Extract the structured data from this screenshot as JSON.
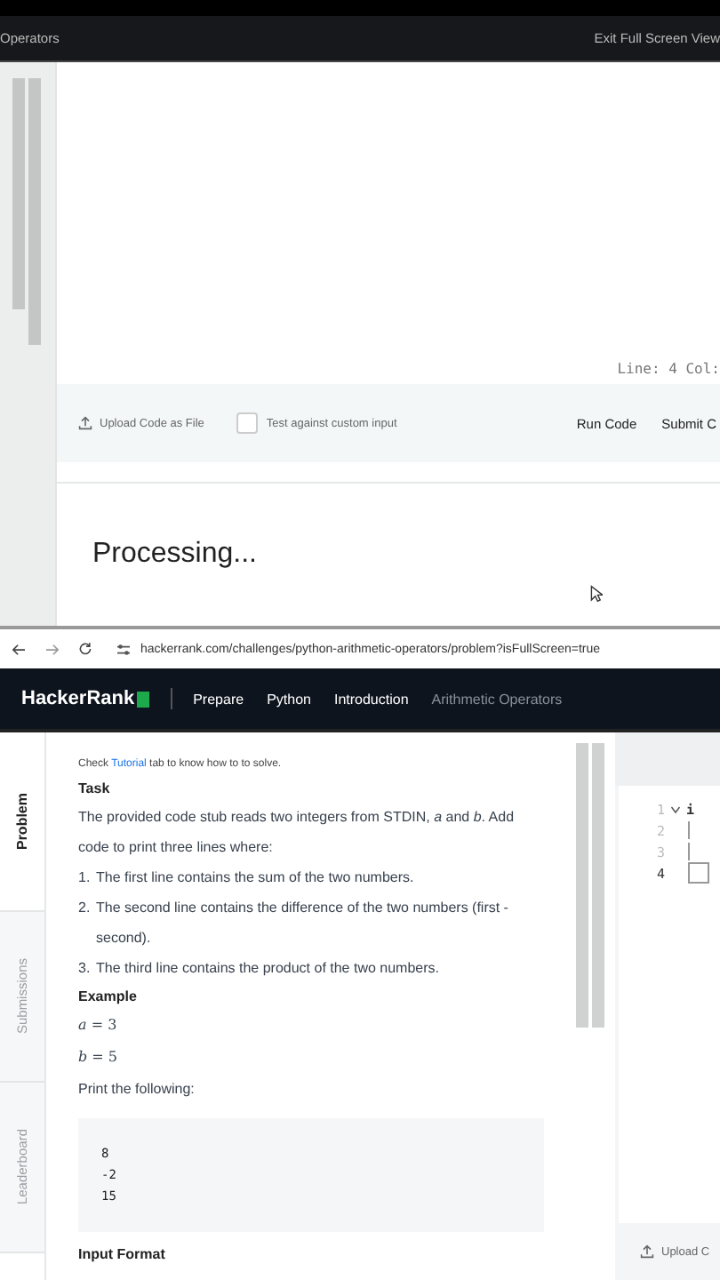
{
  "fullscreen_header": {
    "title": "Operators",
    "exit_link": "Exit Full Screen View"
  },
  "editor": {
    "cursor_position": "Line: 4 Col:"
  },
  "editor_footer": {
    "upload": "Upload Code as File",
    "custom_input": {
      "label": "Test against custom input",
      "checked": false
    },
    "buttons": [
      "Run Code",
      "Submit C"
    ]
  },
  "output": {
    "status": "Processing..."
  },
  "browser": {
    "url": "hackerrank.com/challenges/python-arithmetic-operators/problem?isFullScreen=true"
  },
  "nav": {
    "logo": "HackerRank",
    "breadcrumbs": [
      {
        "label": "Prepare",
        "current": false
      },
      {
        "label": "Python",
        "current": false
      },
      {
        "label": "Introduction",
        "current": false
      },
      {
        "label": "Arithmetic Operators",
        "current": true
      }
    ]
  },
  "side_tabs": [
    {
      "label": "Problem",
      "selected": true
    },
    {
      "label": "Submissions",
      "selected": false
    },
    {
      "label": "Leaderboard",
      "selected": false
    }
  ],
  "problem": {
    "hint_before": "Check",
    "hint_link": "Tutorial",
    "hint_after": "tab to know how to to solve.",
    "task_heading": "Task",
    "task_text": "The provided code stub reads two integers from STDIN, *a* and *b*. Add code to print three lines where:",
    "list": [
      {
        "number": "1.",
        "text": "The first line contains the sum of the two numbers."
      },
      {
        "number": "2.",
        "text": "The second line contains the difference of the two numbers (first - second)."
      },
      {
        "number": "3.",
        "text": "The third line contains the product of the two numbers."
      }
    ],
    "example_heading": "Example",
    "example_values": [
      "*a* = 3",
      "*b* = 5"
    ],
    "print_text": "Print the following:",
    "sample_output": "8\n-2\n15",
    "next_heading": "Input Format"
  },
  "code_editor": {
    "line_numbers": [
      "1",
      "2",
      "3",
      "4"
    ],
    "first_line": "i",
    "upload": "Upload C"
  }
}
